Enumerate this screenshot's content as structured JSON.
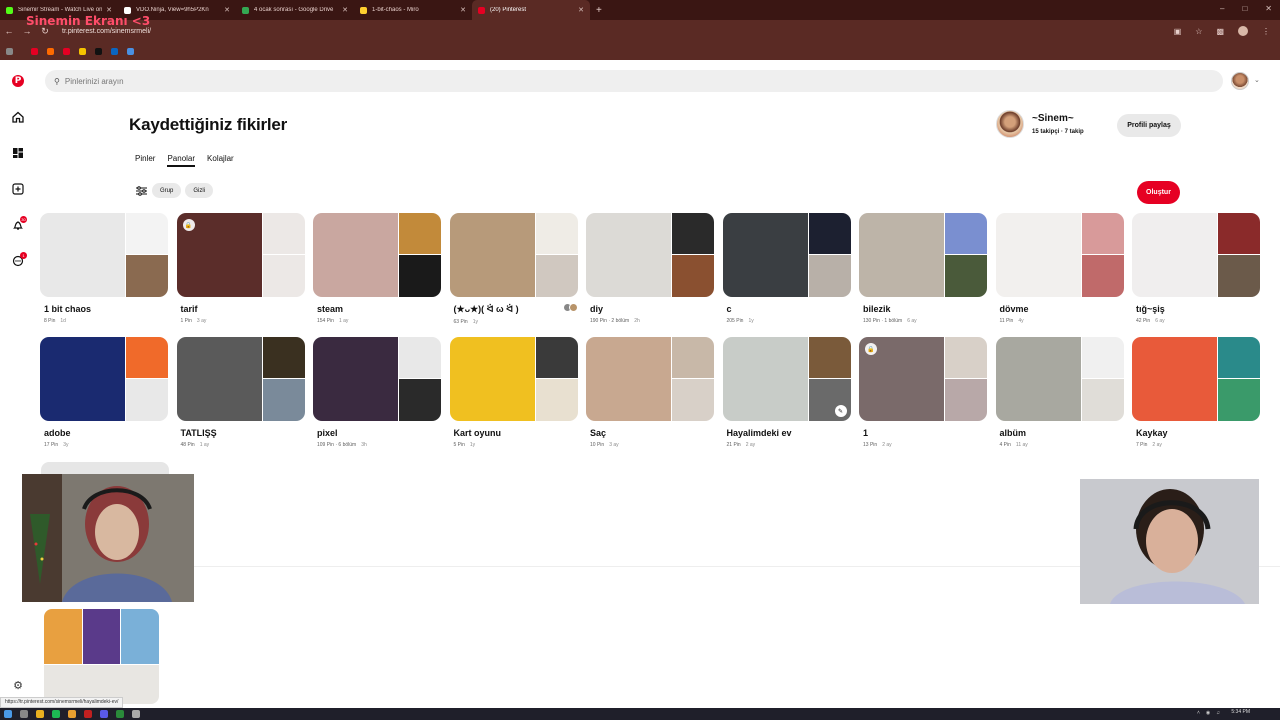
{
  "overlay_title": "Sinemin Ekranı <3",
  "browser": {
    "tabs": [
      {
        "label": "Sinemir Stream - Watch Live on",
        "color": "#53fc18",
        "active": false
      },
      {
        "label": "VDO.Ninja, View=9h5P2Kn",
        "color": "#ffffff",
        "active": false
      },
      {
        "label": "4 ocak sonrası - Google Drive",
        "color": "#34a853",
        "active": false
      },
      {
        "label": "1-bit-chaos - Miro",
        "color": "#ffd02f",
        "active": false
      },
      {
        "label": "(20) Pinterest",
        "color": "#e60023",
        "active": true
      }
    ],
    "new_tab": "+",
    "url": "tr.pinterest.com/sinemsrmeli/",
    "bookmark_colors": [
      "#e60023",
      "#ff6a00",
      "#e60023",
      "#f5c400",
      "#111111",
      "#0a66c2",
      "#4a90e2"
    ]
  },
  "search": {
    "placeholder": "Pinlerinizi arayın"
  },
  "rail": {
    "notif_badge": "30",
    "msg_badge": "1"
  },
  "page": {
    "title": "Kaydettiğiniz fikirler",
    "subtabs": [
      {
        "label": "Pinler",
        "active": false
      },
      {
        "label": "Panolar",
        "active": true
      },
      {
        "label": "Kolajlar",
        "active": false
      }
    ],
    "filter_chips": [
      "Grup",
      "Gizli"
    ],
    "create_label": "Oluştur"
  },
  "profile": {
    "name": "~Sinem~",
    "stats": "15 takipçi · 7 takip",
    "share_label": "Profili paylaş"
  },
  "boards": [
    {
      "name": "1 bit chaos",
      "pins": "8 Pin",
      "time": "1d",
      "colors": [
        "#e8e8e8",
        "#f3f3f3",
        "#8a6a50"
      ]
    },
    {
      "name": "tarif",
      "pins": "1 Pin",
      "time": "3 ay",
      "colors": [
        "#5b2d2a",
        "#ece8e6",
        "#ece8e6"
      ],
      "locked": true
    },
    {
      "name": "steam",
      "pins": "154 Pin",
      "time": "1 ay",
      "colors": [
        "#c9a7a0",
        "#c28a3a",
        "#1a1a1a"
      ]
    },
    {
      "name": "(★ᴗ★)( ᐛ ω ᐛ )",
      "pins": "63 Pin",
      "time": "1y",
      "colors": [
        "#b79a7a",
        "#efece6",
        "#d0c8c0"
      ],
      "collab": true
    },
    {
      "name": "diy",
      "pins": "190 Pin · 2 bölüm",
      "time": "2h",
      "colors": [
        "#dcdad6",
        "#2a2a2a",
        "#8a5030"
      ]
    },
    {
      "name": "c",
      "pins": "205 Pin",
      "time": "1y",
      "colors": [
        "#3a3e42",
        "#1c2030",
        "#b8b0a8"
      ]
    },
    {
      "name": "bilezik",
      "pins": "130 Pin · 1 bölüm",
      "time": "6 ay",
      "colors": [
        "#bdb4a8",
        "#7a8fd0",
        "#4a5a3a"
      ]
    },
    {
      "name": "dövme",
      "pins": "11 Pin",
      "time": "4y",
      "colors": [
        "#f2f0ee",
        "#d89a9a",
        "#c06a6a"
      ]
    },
    {
      "name": "tığ~şiş",
      "pins": "42 Pin",
      "time": "6 ay",
      "colors": [
        "#f0eeee",
        "#8a2a2a",
        "#6b5a4a"
      ]
    },
    {
      "name": "adobe",
      "pins": "17 Pin",
      "time": "3y",
      "colors": [
        "#1a2a70",
        "#f06a2a",
        "#e8e8e8"
      ]
    },
    {
      "name": "TATLIŞŞ",
      "pins": "48 Pin",
      "time": "1 ay",
      "colors": [
        "#5a5a5a",
        "#3a3020",
        "#7a8a9a"
      ]
    },
    {
      "name": "pixel",
      "pins": "109 Pin · 6 bölüm",
      "time": "3h",
      "colors": [
        "#3a2a40",
        "#e8e8e8",
        "#2a2a2a"
      ]
    },
    {
      "name": "Kart oyunu",
      "pins": "5 Pin",
      "time": "1y",
      "colors": [
        "#f0c020",
        "#3a3a3a",
        "#e8e0d0"
      ]
    },
    {
      "name": "Saç",
      "pins": "10 Pin",
      "time": "3 ay",
      "colors": [
        "#c8a890",
        "#c8b8a8",
        "#d8d0c8"
      ]
    },
    {
      "name": "Hayalimdeki ev",
      "pins": "21 Pin",
      "time": "2 ay",
      "colors": [
        "#c8ccc8",
        "#7a5a3a",
        "#6a6a6a"
      ],
      "edit": true
    },
    {
      "name": "1",
      "pins": "13 Pin",
      "time": "2 ay",
      "colors": [
        "#7a6a6a",
        "#d8d0c8",
        "#b8a8a8"
      ],
      "locked": true
    },
    {
      "name": "albüm",
      "pins": "4 Pin",
      "time": "11 ay",
      "colors": [
        "#a8a8a0",
        "#f0f0f0",
        "#e0ddd8"
      ]
    },
    {
      "name": "Kaykay",
      "pins": "7 Pin",
      "time": "2 ay",
      "colors": [
        "#e85a3a",
        "#2a8a8a",
        "#3a9a6a"
      ]
    }
  ],
  "status_url": "https://tr.pinterest.com/sinemsrmeli/hayalimdeki-ev/",
  "taskbar": {
    "time": "5:34 PM"
  }
}
